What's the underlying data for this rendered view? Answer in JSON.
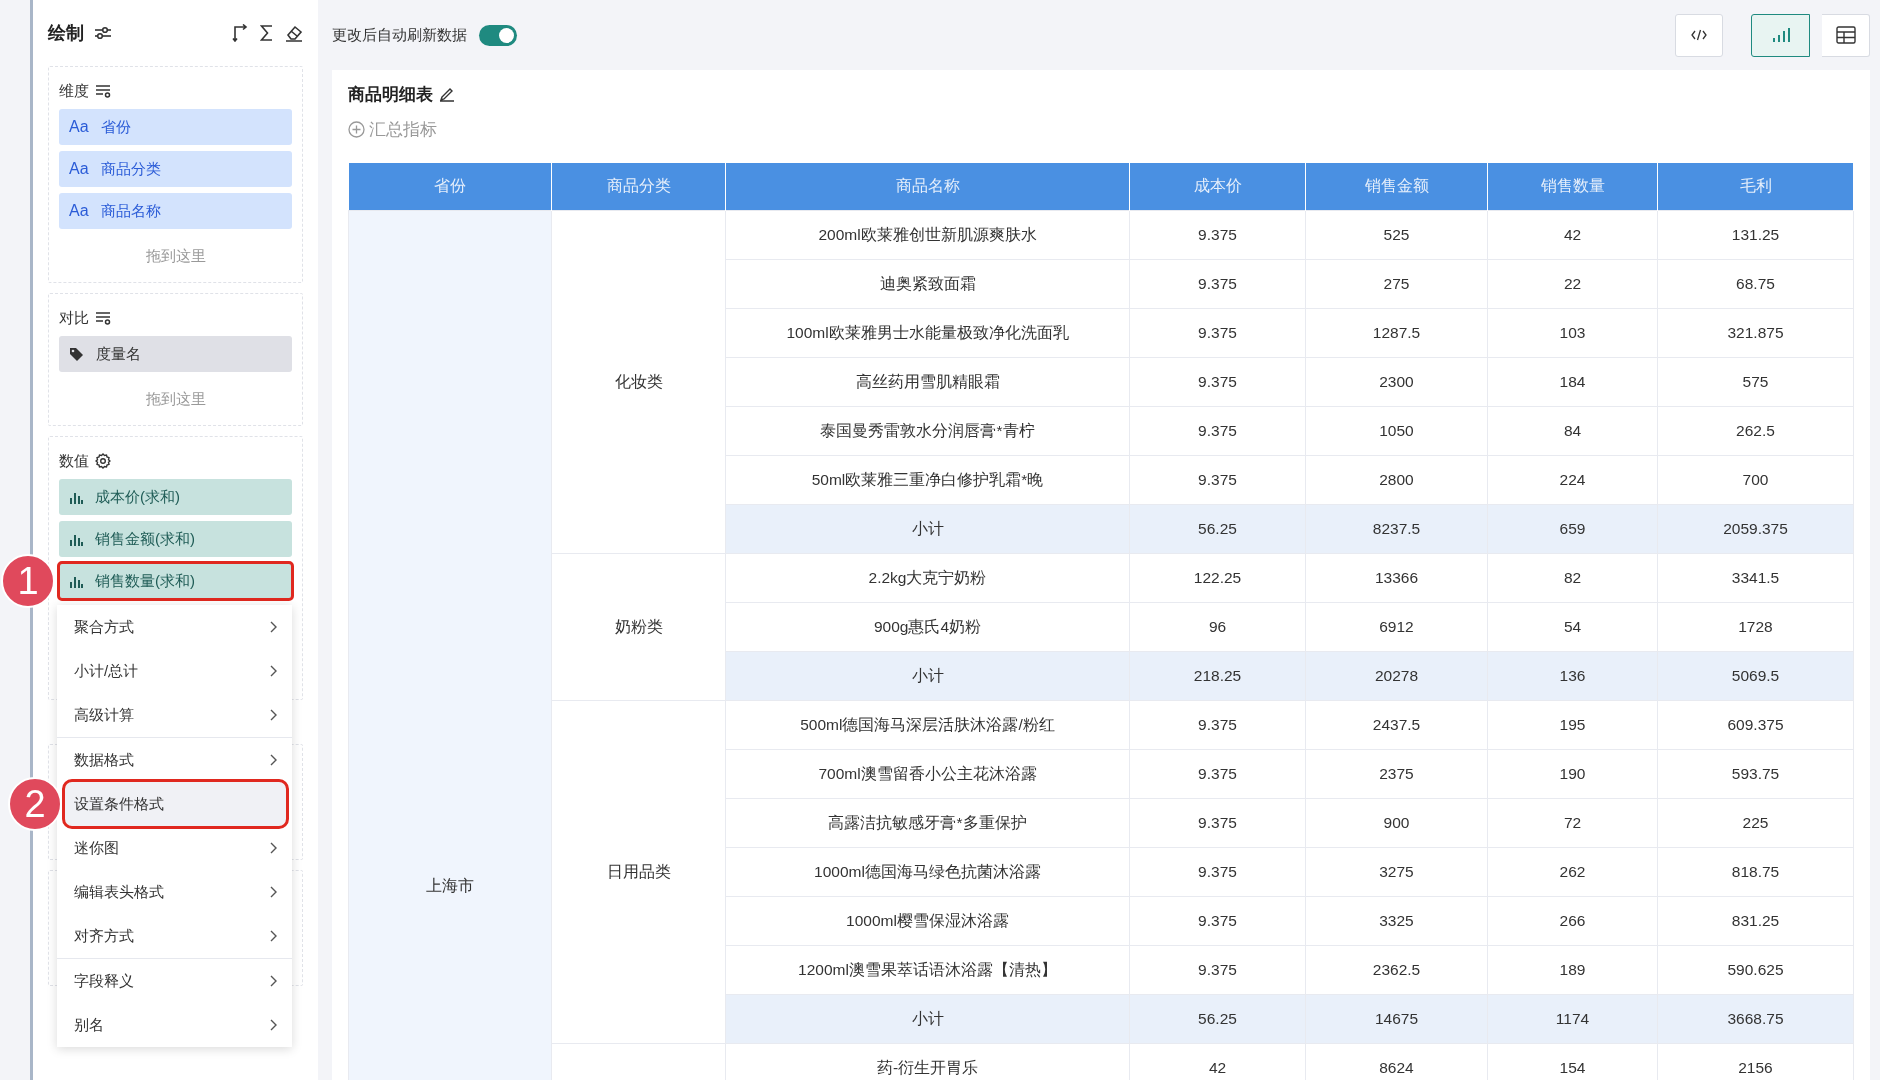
{
  "sidebar": {
    "title": "绘制",
    "dimensions": {
      "heading": "维度",
      "items": [
        {
          "type_label": "Aa",
          "name": "省份"
        },
        {
          "type_label": "Aa",
          "name": "商品分类"
        },
        {
          "type_label": "Aa",
          "name": "商品名称"
        }
      ],
      "drop_hint": "拖到这里"
    },
    "comparison": {
      "heading": "对比",
      "items": [
        {
          "name": "度量名"
        }
      ],
      "drop_hint": "拖到这里"
    },
    "measures": {
      "heading": "数值",
      "items": [
        {
          "name": "成本价(求和)"
        },
        {
          "name": "销售金额(求和)"
        },
        {
          "name": "销售数量(求和)",
          "callout": "1"
        }
      ]
    }
  },
  "context_menu": {
    "items": [
      {
        "label": "聚合方式",
        "has_submenu": true,
        "highlighted": false,
        "divider_after": false
      },
      {
        "label": "小计/总计",
        "has_submenu": true,
        "highlighted": false,
        "divider_after": false
      },
      {
        "label": "高级计算",
        "has_submenu": true,
        "highlighted": false,
        "divider_after": true
      },
      {
        "label": "数据格式",
        "has_submenu": true,
        "highlighted": false,
        "divider_after": false
      },
      {
        "label": "设置条件格式",
        "has_submenu": false,
        "highlighted": true,
        "divider_after": false,
        "callout": "2"
      },
      {
        "label": "迷你图",
        "has_submenu": true,
        "highlighted": false,
        "divider_after": false
      },
      {
        "label": "编辑表头格式",
        "has_submenu": true,
        "highlighted": false,
        "divider_after": false
      },
      {
        "label": "对齐方式",
        "has_submenu": true,
        "highlighted": false,
        "divider_after": true
      },
      {
        "label": "字段释义",
        "has_submenu": true,
        "highlighted": false,
        "divider_after": false
      },
      {
        "label": "别名",
        "has_submenu": true,
        "highlighted": false,
        "divider_after": false
      }
    ]
  },
  "toolbar": {
    "auto_refresh": {
      "label": "更改后自动刷新数据",
      "on": true
    },
    "view_buttons": [
      {
        "kind": "code",
        "selected": false
      },
      {
        "kind": "chart",
        "selected": true
      },
      {
        "kind": "table",
        "selected": false
      }
    ]
  },
  "report": {
    "title": "商品明细表",
    "summary_link": "汇总指标",
    "table": {
      "columns": [
        "省份",
        "商品分类",
        "商品名称",
        "成本价",
        "销售金额",
        "销售数量",
        "毛利"
      ],
      "groups": [
        {
          "province": "上海市",
          "categories": [
            {
              "name": "化妆类",
              "rows": [
                {
                  "kind": "item",
                  "cells": [
                    "200ml欧莱雅创世新肌源爽肤水",
                    "9.375",
                    "525",
                    "42",
                    "131.25"
                  ]
                },
                {
                  "kind": "item",
                  "cells": [
                    "迪奥紧致面霜",
                    "9.375",
                    "275",
                    "22",
                    "68.75"
                  ]
                },
                {
                  "kind": "item",
                  "cells": [
                    "100ml欧莱雅男士水能量极致净化洗面乳",
                    "9.375",
                    "1287.5",
                    "103",
                    "321.875"
                  ]
                },
                {
                  "kind": "item",
                  "cells": [
                    "高丝药用雪肌精眼霜",
                    "9.375",
                    "2300",
                    "184",
                    "575"
                  ]
                },
                {
                  "kind": "item",
                  "cells": [
                    "泰国曼秀雷敦水分润唇膏*青柠",
                    "9.375",
                    "1050",
                    "84",
                    "262.5"
                  ]
                },
                {
                  "kind": "item",
                  "cells": [
                    "50ml欧莱雅三重净白修护乳霜*晚",
                    "9.375",
                    "2800",
                    "224",
                    "700"
                  ]
                },
                {
                  "kind": "subtotal",
                  "cells": [
                    "小计",
                    "56.25",
                    "8237.5",
                    "659",
                    "2059.375"
                  ]
                }
              ]
            },
            {
              "name": "奶粉类",
              "rows": [
                {
                  "kind": "item",
                  "cells": [
                    "2.2kg大克宁奶粉",
                    "122.25",
                    "13366",
                    "82",
                    "3341.5"
                  ]
                },
                {
                  "kind": "item",
                  "cells": [
                    "900g惠氏4奶粉",
                    "96",
                    "6912",
                    "54",
                    "1728"
                  ]
                },
                {
                  "kind": "subtotal",
                  "cells": [
                    "小计",
                    "218.25",
                    "20278",
                    "136",
                    "5069.5"
                  ]
                }
              ]
            },
            {
              "name": "日用品类",
              "rows": [
                {
                  "kind": "item",
                  "cells": [
                    "500ml德国海马深层活肤沐浴露/粉红",
                    "9.375",
                    "2437.5",
                    "195",
                    "609.375"
                  ]
                },
                {
                  "kind": "item",
                  "cells": [
                    "700ml澳雪留香小公主花沐浴露",
                    "9.375",
                    "2375",
                    "190",
                    "593.75"
                  ]
                },
                {
                  "kind": "item",
                  "cells": [
                    "高露洁抗敏感牙膏*多重保护",
                    "9.375",
                    "900",
                    "72",
                    "225"
                  ]
                },
                {
                  "kind": "item",
                  "cells": [
                    "1000ml德国海马绿色抗菌沐浴露",
                    "9.375",
                    "3275",
                    "262",
                    "818.75"
                  ]
                },
                {
                  "kind": "item",
                  "cells": [
                    "1000ml樱雪保湿沐浴露",
                    "9.375",
                    "3325",
                    "266",
                    "831.25"
                  ]
                },
                {
                  "kind": "item",
                  "cells": [
                    "1200ml澳雪果萃话语沐浴露【清热】",
                    "9.375",
                    "2362.5",
                    "189",
                    "590.625"
                  ]
                },
                {
                  "kind": "subtotal",
                  "cells": [
                    "小计",
                    "56.25",
                    "14675",
                    "1174",
                    "3668.75"
                  ]
                }
              ]
            },
            {
              "rows": [
                {
                  "kind": "item",
                  "cells": [
                    "药-衍生开胃乐",
                    "42",
                    "8624",
                    "154",
                    "2156"
                  ]
                }
              ]
            }
          ]
        }
      ]
    }
  }
}
